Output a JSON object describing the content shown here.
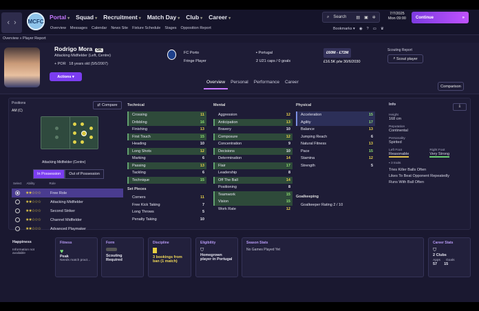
{
  "nav": {
    "menu": [
      {
        "label": "Portal",
        "active": true
      },
      {
        "label": "Squad"
      },
      {
        "label": "Recruitment"
      },
      {
        "label": "Match Day"
      },
      {
        "label": "Club"
      },
      {
        "label": "Career"
      }
    ],
    "submenu": [
      "Overview",
      "Messages",
      "Calendar",
      "News Site",
      "Fixture Schedule",
      "Stages",
      "Opposition Report"
    ],
    "search": "Search",
    "date_line1": "7/7/2025",
    "date_line2": "Mon 09:00",
    "continue": "Continue",
    "bookmarks": "Bookmarks",
    "crest_text": "MCFC"
  },
  "breadcrumb": [
    "Overview",
    "Player Report"
  ],
  "player": {
    "name": "Rodrigo Mora",
    "rating": "OK",
    "position": "Attacking Midfielder (Left, Centre)",
    "age_line": "18 years old (5/5/2007)",
    "nat_code": "POR",
    "actions": "Actions",
    "club": "FC Porto",
    "club_status": "Fringe Player",
    "nation": "Portugal",
    "caps": "2 U21 caps / 0 goals",
    "value": "£60M - £72M",
    "wage": "£16.5K p/w 30/6/2030",
    "scout_title": "Scouting Report",
    "scout_btn": "Scout player",
    "comparison": "Comparison"
  },
  "tabs": [
    "Overview",
    "Personal",
    "Performance",
    "Career"
  ],
  "left": {
    "positions_label": "Positions",
    "position_code": "AM (C)",
    "compare": "Compare",
    "role_label": "Attacking Midfielder (Centre)",
    "in_possession": "In Possession",
    "out_possession": "Out of Possession",
    "col_select": "Select",
    "col_ability": "Ability",
    "col_role": "Role",
    "roles": [
      {
        "name": "Free Role",
        "stars": 2,
        "selected": true
      },
      {
        "name": "Attacking Midfielder",
        "stars": 2
      },
      {
        "name": "Second Striker",
        "stars": 2
      },
      {
        "name": "Channel Midfielder",
        "stars": 2
      },
      {
        "name": "Advanced Playmaker",
        "stars": 2
      }
    ]
  },
  "technical": {
    "title": "Technical",
    "attrs": [
      {
        "n": "Crossing",
        "v": "11",
        "c": "y",
        "hl": true
      },
      {
        "n": "Dribbling",
        "v": "16",
        "c": "g",
        "hl": true
      },
      {
        "n": "Finishing",
        "v": "13",
        "c": "y"
      },
      {
        "n": "First Touch",
        "v": "15",
        "c": "g",
        "hl": true
      },
      {
        "n": "Heading",
        "v": "10",
        "c": "w"
      },
      {
        "n": "Long Shots",
        "v": "12",
        "c": "y",
        "hl": true
      },
      {
        "n": "Marking",
        "v": "6",
        "c": "w"
      },
      {
        "n": "Passing",
        "v": "13",
        "c": "y",
        "hl": true
      },
      {
        "n": "Tackling",
        "v": "6",
        "c": "w"
      },
      {
        "n": "Technique",
        "v": "15",
        "c": "g",
        "hl": true
      }
    ],
    "setpieces_title": "Set Pieces",
    "setpieces": [
      {
        "n": "Corners",
        "v": "11",
        "c": "y"
      },
      {
        "n": "Free Kick Taking",
        "v": "7",
        "c": "w"
      },
      {
        "n": "Long Throws",
        "v": "5",
        "c": "w"
      },
      {
        "n": "Penalty Taking",
        "v": "10",
        "c": "w"
      }
    ]
  },
  "mental": {
    "title": "Mental",
    "attrs": [
      {
        "n": "Aggression",
        "v": "12",
        "c": "y"
      },
      {
        "n": "Anticipation",
        "v": "13",
        "c": "y",
        "hl": true
      },
      {
        "n": "Bravery",
        "v": "10",
        "c": "w"
      },
      {
        "n": "Composure",
        "v": "12",
        "c": "y",
        "hl": true
      },
      {
        "n": "Concentration",
        "v": "9",
        "c": "w"
      },
      {
        "n": "Decisions",
        "v": "10",
        "c": "w",
        "hl": true
      },
      {
        "n": "Determination",
        "v": "14",
        "c": "y"
      },
      {
        "n": "Flair",
        "v": "17",
        "c": "g",
        "hl": true
      },
      {
        "n": "Leadership",
        "v": "8",
        "c": "w"
      },
      {
        "n": "Off The Ball",
        "v": "14",
        "c": "y",
        "hl": true
      },
      {
        "n": "Positioning",
        "v": "8",
        "c": "w"
      },
      {
        "n": "Teamwork",
        "v": "15",
        "c": "g",
        "hl": true
      },
      {
        "n": "Vision",
        "v": "15",
        "c": "g",
        "hl": true
      },
      {
        "n": "Work Rate",
        "v": "12",
        "c": "y"
      }
    ]
  },
  "physical": {
    "title": "Physical",
    "attrs": [
      {
        "n": "Acceleration",
        "v": "15",
        "c": "g",
        "hl": true
      },
      {
        "n": "Agility",
        "v": "17",
        "c": "g",
        "hl": true
      },
      {
        "n": "Balance",
        "v": "13",
        "c": "y"
      },
      {
        "n": "Jumping Reach",
        "v": "6",
        "c": "w"
      },
      {
        "n": "Natural Fitness",
        "v": "13",
        "c": "y"
      },
      {
        "n": "Pace",
        "v": "15",
        "c": "g"
      },
      {
        "n": "Stamina",
        "v": "12",
        "c": "y"
      },
      {
        "n": "Strength",
        "v": "5",
        "c": "w"
      }
    ],
    "gk_title": "Goalkeeping",
    "gk_rating": "Goalkeeper Rating",
    "gk_value": "2 / 10"
  },
  "info": {
    "title": "Info",
    "height_label": "Height",
    "height": "168 cm",
    "rep_label": "Reputation",
    "rep": "Continental",
    "pers_label": "Personality",
    "pers": "Spirited",
    "lf_label": "Left Foot",
    "lf": "Reasonable",
    "rf_label": "Right Foot",
    "rf": "Very Strong",
    "traits_label": "3 traits",
    "traits": [
      "Tries Killer Balls Often",
      "Likes To Beat Opponent Repeatedly",
      "Runs With Ball Often"
    ]
  },
  "cards": {
    "happiness": {
      "title": "Happiness",
      "text": "Information not available"
    },
    "fitness": {
      "title": "Fitness",
      "value": "Peak",
      "sub": "Needs match pract..."
    },
    "form": {
      "title": "Form",
      "value": "Scouting Required"
    },
    "discipline": {
      "title": "Discipline",
      "value": "3 bookings from ban (1 match)"
    },
    "eligibility": {
      "title": "Eligibility",
      "value": "Homegrown player in Portugal"
    },
    "season": {
      "title": "Season Stats",
      "value": "No Games Played Yet"
    },
    "career": {
      "title": "Career Stats",
      "clubs": "2 Clubs",
      "apps_label": "Apps",
      "apps": "57",
      "goals_label": "Goals",
      "goals": "15"
    }
  }
}
